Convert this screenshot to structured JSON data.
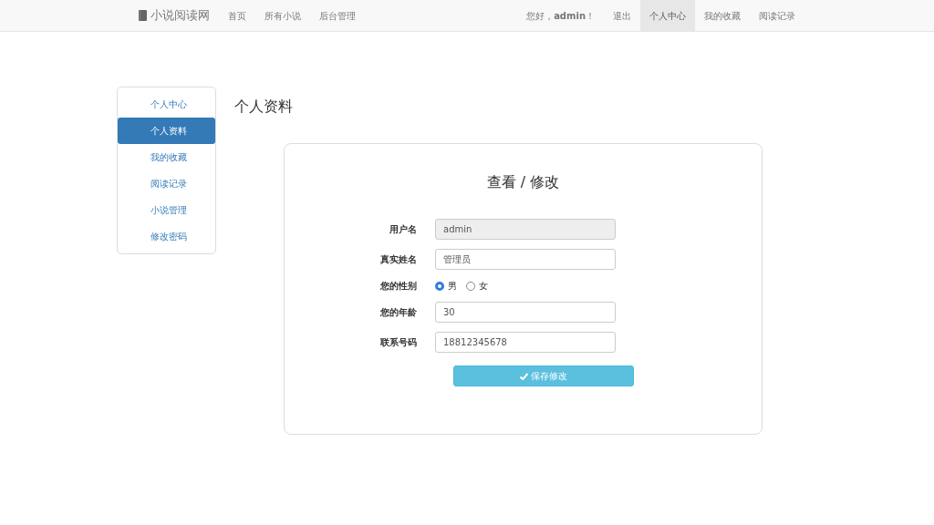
{
  "navbar": {
    "brand": "小说阅读网",
    "left_links": [
      {
        "label": "首页",
        "selected": false
      },
      {
        "label": "所有小说",
        "selected": false
      },
      {
        "label": "后台管理",
        "selected": false
      }
    ],
    "greeting": "您好，**admin**！",
    "right_links": [
      {
        "label": "退出",
        "selected": false
      },
      {
        "label": "个人中心",
        "selected": true
      },
      {
        "label": "我的收藏",
        "selected": false
      },
      {
        "label": "阅读记录",
        "selected": false
      }
    ]
  },
  "sidebar": {
    "items": [
      {
        "label": "个人中心",
        "selected": false
      },
      {
        "label": "个人资料",
        "selected": true
      },
      {
        "label": "我的收藏",
        "selected": false
      },
      {
        "label": "阅读记录",
        "selected": false
      },
      {
        "label": "小说管理",
        "selected": false
      },
      {
        "label": "修改密码",
        "selected": false
      }
    ]
  },
  "page_title": "个人资料",
  "form": {
    "title": "查看 / 修改",
    "fields": [
      {
        "kind": "text",
        "label": "用户名",
        "value": "admin",
        "disabled": true
      },
      {
        "kind": "text",
        "label": "真实姓名",
        "value": "管理员",
        "disabled": false
      },
      {
        "kind": "radio",
        "label": "您的性别",
        "options": [
          {
            "label": "男",
            "selected": true
          },
          {
            "label": "女",
            "selected": false
          }
        ]
      },
      {
        "kind": "text",
        "label": "您的年龄",
        "value": "30",
        "disabled": false
      },
      {
        "kind": "text",
        "label": "联系号码",
        "value": "18812345678",
        "disabled": false
      }
    ],
    "submit": "保存修改"
  }
}
